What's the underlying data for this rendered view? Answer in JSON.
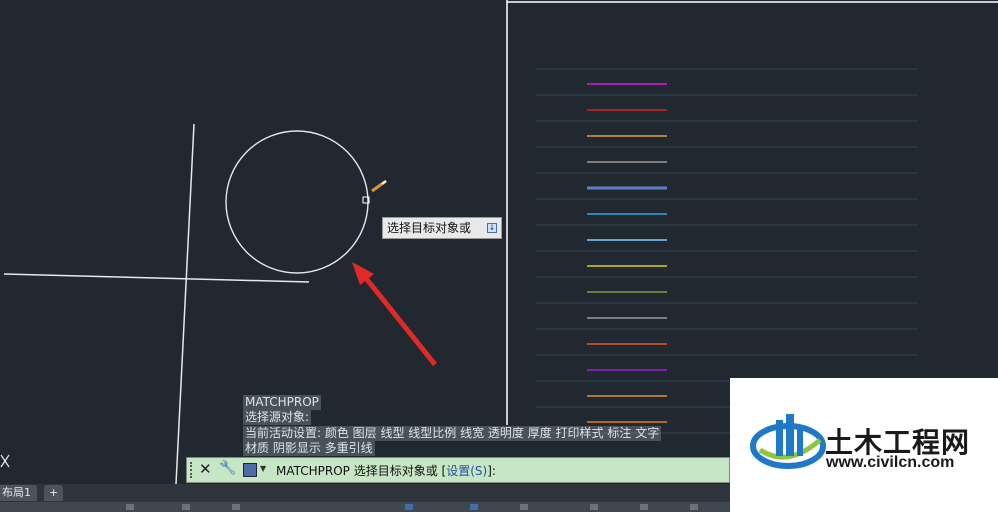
{
  "tooltip": {
    "text": "选择目标对象或"
  },
  "history": {
    "line1": "MATCHPROP",
    "line2": "选择源对象:",
    "line3": "当前活动设置:  颜色  图层  线型  线型比例  线宽  透明度  厚度  打印样式  标注  文字",
    "line4": "材质  阴影显示  多重引线"
  },
  "command": {
    "text": "MATCHPROP 选择目标对象或 [",
    "option": "设置(S)",
    "suffix": "]:"
  },
  "tabs": {
    "layout1": "布局1",
    "add": "+"
  },
  "watermark": {
    "title": "土木工程网",
    "url": "www.civilcn.com"
  },
  "colors": {
    "background": "#212830",
    "legend_lines": [
      "#d81bd8",
      "#d02424",
      "#e0a040",
      "#9a9a9a",
      "#5f7fc8",
      "#2aa9e0",
      "#7fd0ff",
      "#d8d020",
      "#7f9a40",
      "#9a9a9a",
      "#e05a1a",
      "#a020d0",
      "#e09040",
      "#e08020"
    ]
  }
}
